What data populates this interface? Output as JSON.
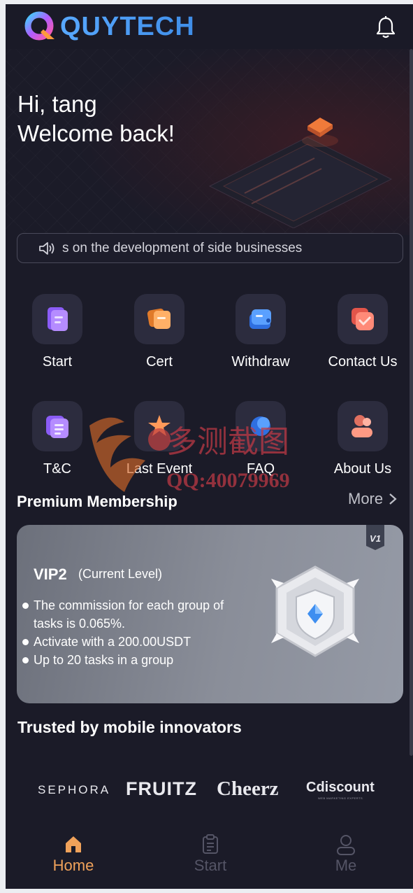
{
  "header": {
    "brand": "QUYTECH",
    "notifications_icon": "bell-icon"
  },
  "hero": {
    "greeting_line1": "Hi, tang",
    "greeting_line2": "Welcome back!"
  },
  "notice": {
    "icon": "speaker-icon",
    "text": "s on the development of side businesses"
  },
  "menu": [
    {
      "label": "Start",
      "icon": "document-icon"
    },
    {
      "label": "Cert",
      "icon": "certificate-icon"
    },
    {
      "label": "Withdraw",
      "icon": "wallet-icon"
    },
    {
      "label": "Contact Us",
      "icon": "chat-icon"
    },
    {
      "label": "T&C",
      "icon": "terms-icon"
    },
    {
      "label": "Last Event",
      "icon": "event-icon"
    },
    {
      "label": "FAQ",
      "icon": "faq-icon"
    },
    {
      "label": "About Us",
      "icon": "people-icon"
    }
  ],
  "membership": {
    "section_title": "Premium Membership",
    "more_label": "More",
    "badge": "V1",
    "level": "VIP2",
    "current_label": "(Current Level)",
    "benefits": [
      "The commission for each group of tasks is 0.065%.",
      "Activate with a 200.00USDT",
      "Up to 20 tasks in a group"
    ]
  },
  "trusted": {
    "title": "Trusted by mobile innovators",
    "brands": [
      "SEPHORA",
      "FRUITZ",
      "Cheerz",
      "Cdiscount"
    ],
    "brand_tagline": "WEB MARKETING EXPERTS"
  },
  "watermark": {
    "text_cn": "多测截图",
    "text_qq": "QQ:40079969"
  },
  "tabbar": {
    "items": [
      {
        "label": "Home",
        "icon": "home-icon",
        "active": true
      },
      {
        "label": "Start",
        "icon": "clipboard-icon",
        "active": false
      },
      {
        "label": "Me",
        "icon": "user-icon",
        "active": false
      }
    ],
    "active_color": "#f0a25a",
    "inactive_color": "#555566"
  }
}
